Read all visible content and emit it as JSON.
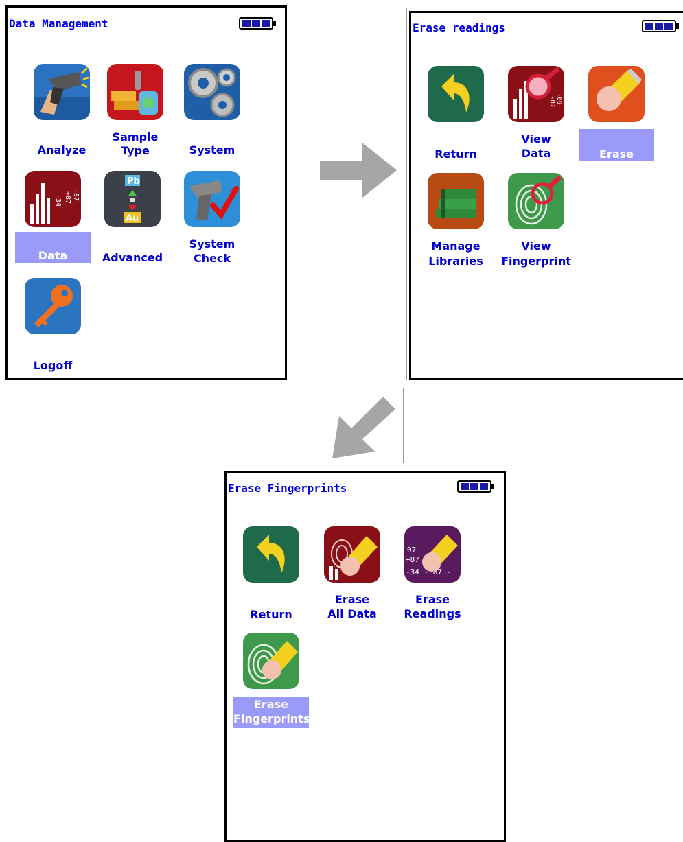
{
  "screens": {
    "data_management": {
      "title": "Data Management",
      "tiles": {
        "analyze": {
          "label": "Analyze"
        },
        "sample_type": {
          "line1": "Sample",
          "line2": "Type"
        },
        "system": {
          "label": "System"
        },
        "data": {
          "label": "Data"
        },
        "advanced": {
          "label": "Advanced",
          "icon_top": "Pb",
          "icon_bottom": "Au"
        },
        "system_check": {
          "line1": "System",
          "line2": "Check"
        },
        "logoff": {
          "label": "Logoff"
        }
      }
    },
    "erase_readings": {
      "title": "Erase readings",
      "tiles": {
        "return": {
          "label": "Return"
        },
        "view_data": {
          "line1": "View",
          "line2": "Data"
        },
        "erase": {
          "label": "Erase"
        },
        "manage_libraries": {
          "line1": "Manage",
          "line2": "Libraries"
        },
        "view_fingerprint": {
          "line1": "View",
          "line2": "Fingerprint"
        }
      }
    },
    "erase_fingerprints": {
      "title": "Erase Fingerprints",
      "tiles": {
        "return": {
          "label": "Return"
        },
        "erase_all_data": {
          "line1": "Erase",
          "line2": "All Data"
        },
        "erase_readings": {
          "line1": "Erase",
          "line2": "Readings",
          "icon_text": [
            "07",
            "+87",
            "-34 - 87 -"
          ]
        },
        "erase_fingerprints": {
          "line1": "Erase",
          "line2": "Fingerprints"
        }
      }
    }
  },
  "icons": {
    "analyzer-gun": "analyzer-gun-icon",
    "gold-bars": "gold-bars-icon",
    "gears": "gears-icon",
    "chart-data": "chart-data-icon",
    "element-conversion": "element-conversion-icon",
    "check-analyzer": "system-check-icon",
    "key": "key-icon",
    "return-arrow": "return-arrow-icon",
    "magnifier-data": "view-data-icon",
    "eraser": "eraser-icon",
    "books": "books-icon",
    "fingerprint-magnifier": "view-fingerprint-icon"
  },
  "colors": {
    "label_blue": "#0000cc",
    "title_blue": "#0000e0",
    "selection": "#9a9af8",
    "arrow_gray": "#a6a6a6"
  }
}
